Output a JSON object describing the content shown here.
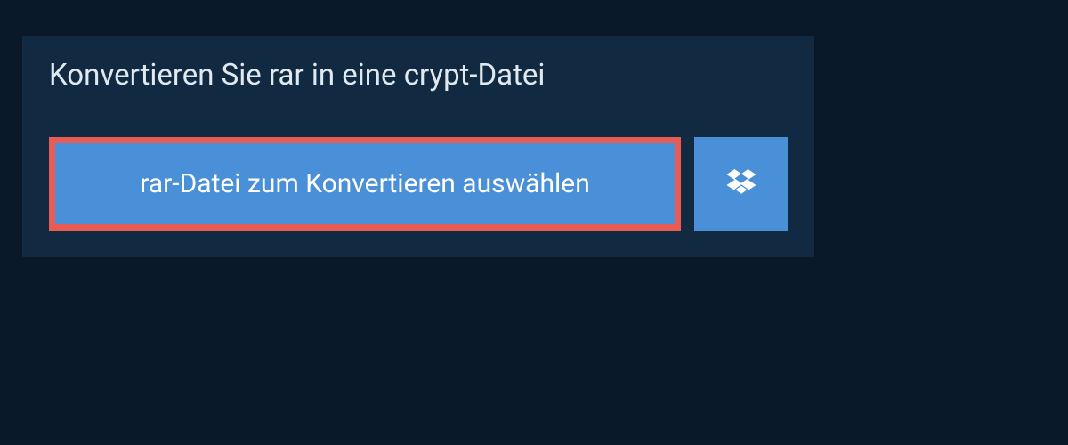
{
  "title": "Konvertieren Sie rar in eine crypt-Datei",
  "buttons": {
    "select_file_label": "rar-Datei zum Konvertieren auswählen"
  },
  "colors": {
    "page_bg": "#0a1929",
    "panel_bg": "#112a42",
    "button_bg": "#4a90d9",
    "highlight_border": "#e85c54",
    "text_light": "#e0e8f0",
    "text_white": "#ffffff"
  }
}
